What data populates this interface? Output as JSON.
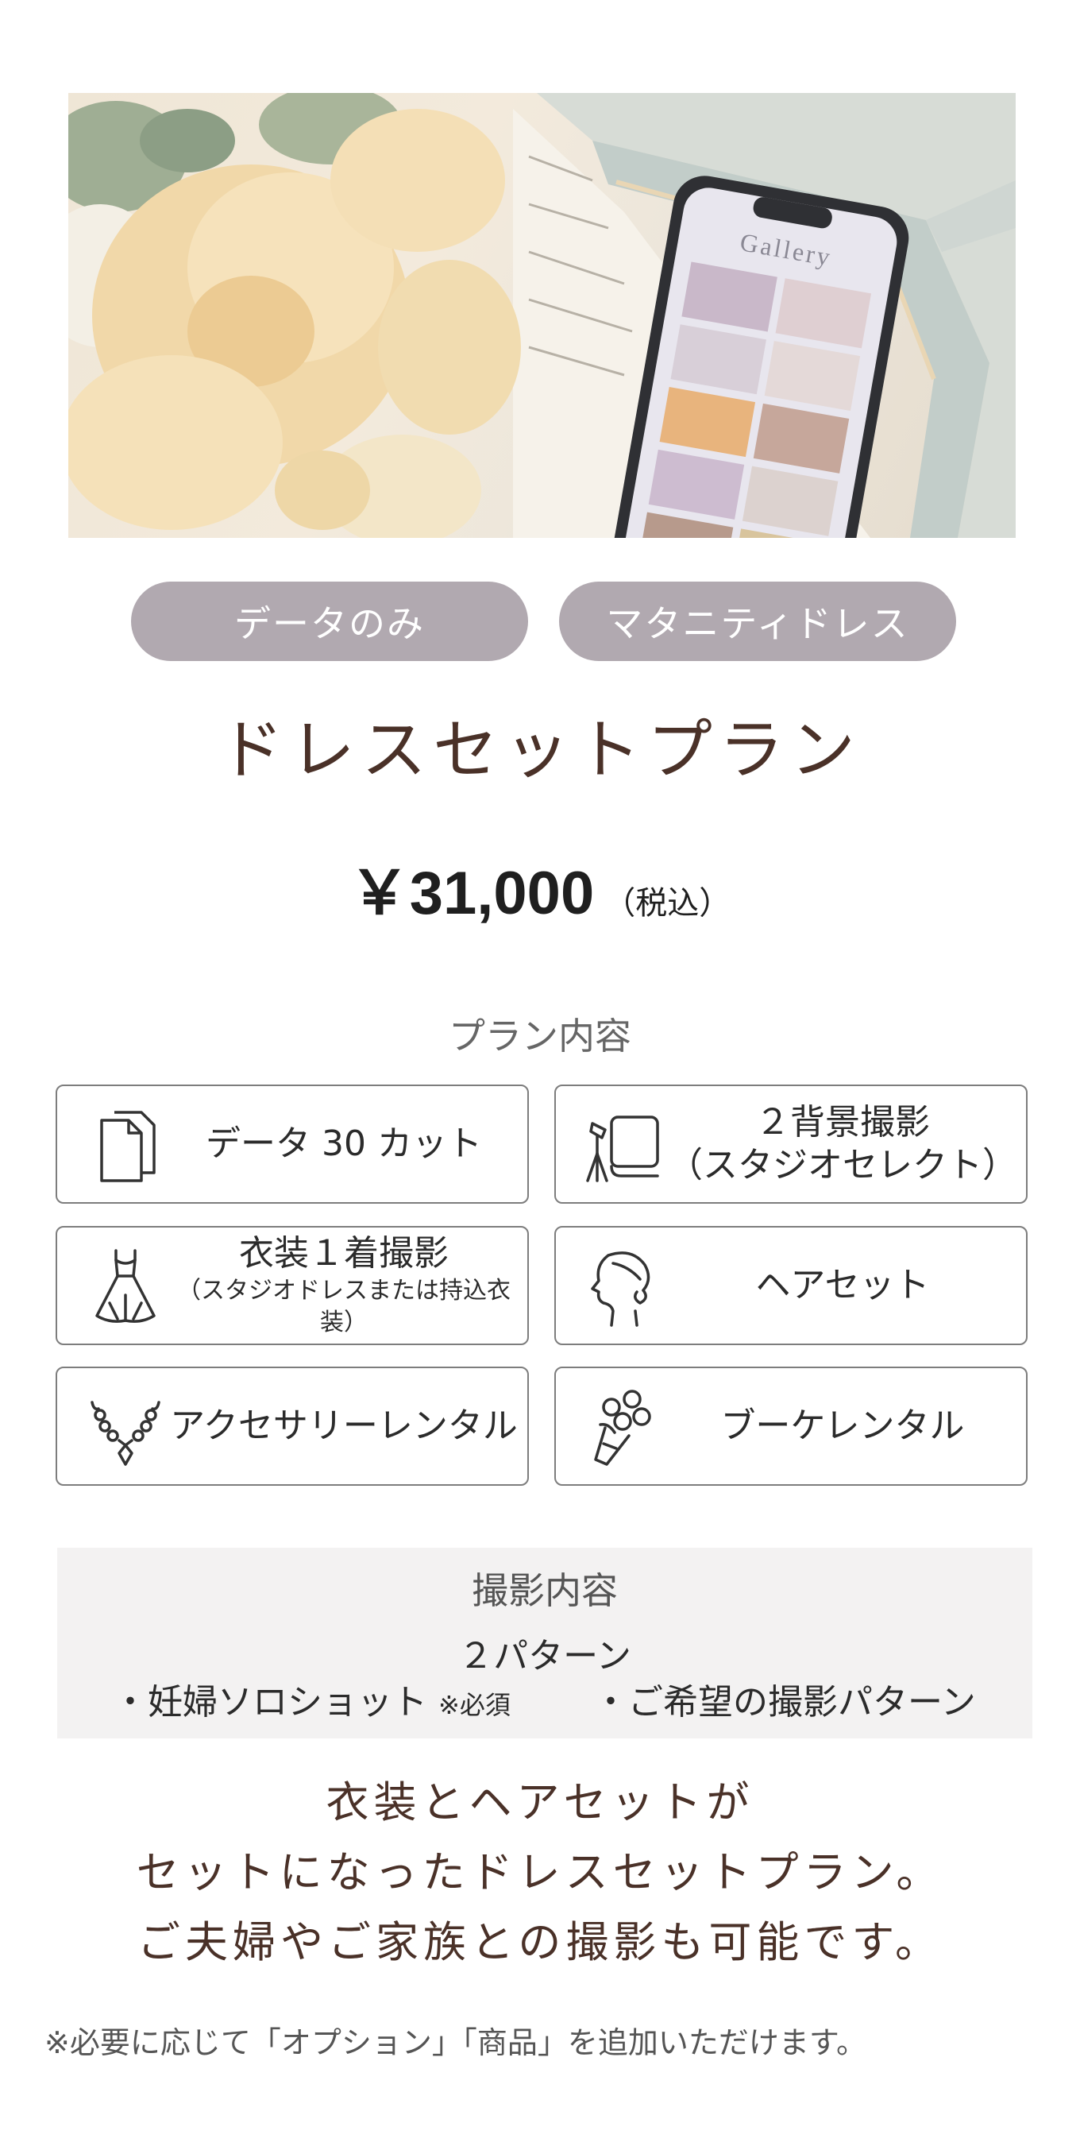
{
  "hero": {
    "screen_title": "Gallery"
  },
  "tags": [
    "データのみ",
    "マタニティドレス"
  ],
  "plan": {
    "title": "ドレスセットプラン",
    "price": "￥31,000",
    "tax": "（税込）"
  },
  "contents": {
    "heading": "プラン内容",
    "items": [
      {
        "icon": "document-icon",
        "line1": "データ 30 カット",
        "line2": ""
      },
      {
        "icon": "studio-backdrop-icon",
        "line1": "２背景撮影",
        "line2": "（スタジオセレクト）"
      },
      {
        "icon": "dress-icon",
        "line1": "衣装１着撮影",
        "line2": "（スタジオドレスまたは持込衣装）"
      },
      {
        "icon": "hairstyle-icon",
        "line1": "ヘアセット",
        "line2": ""
      },
      {
        "icon": "necklace-icon",
        "line1": "アクセサリーレンタル",
        "line2": ""
      },
      {
        "icon": "bouquet-icon",
        "line1": "ブーケレンタル",
        "line2": ""
      }
    ]
  },
  "shoot": {
    "heading": "撮影内容",
    "pattern": "２パターン",
    "item1": "・妊婦ソロショット",
    "item1_note": "※必須",
    "item2": "・ご希望の撮影パターン"
  },
  "description": {
    "line1": "衣装とヘアセットが",
    "line2": "セットになったドレスセットプラン。",
    "line3": "ご夫婦やご家族との撮影も可能です。"
  },
  "footnote": "※必要に応じて「オプション」「商品」を追加いただけます。"
}
